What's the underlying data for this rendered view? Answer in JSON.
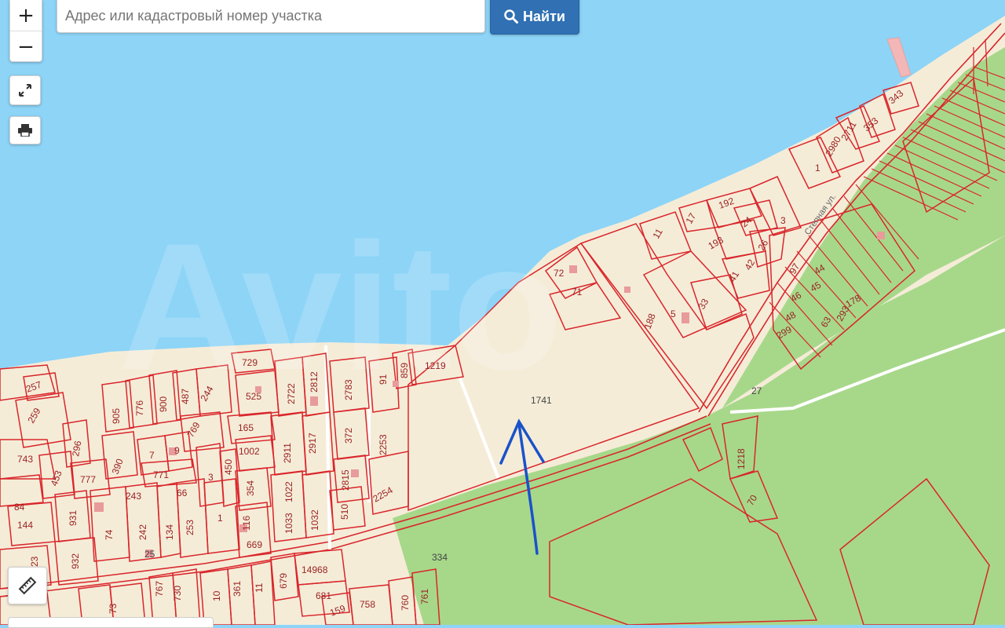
{
  "search": {
    "placeholder": "Адрес или кадастровый номер участка",
    "button_label": "Найти"
  },
  "controls": {
    "zoom_in": "+",
    "zoom_out": "−"
  },
  "watermark": "Avito",
  "street_label": "Степная ул.",
  "colors": {
    "water": "#8dd4f7",
    "land": "#f5ecd8",
    "forest": "#a7d88a",
    "parcel_border": "#d9262b",
    "arrow": "#1a52c9",
    "button": "#3070b3"
  },
  "parcels": {
    "p1741": "1741",
    "p334": "334",
    "p1219": "1219",
    "p2254": "2254",
    "p1218": "1218",
    "p70": "70",
    "p27": "27",
    "p188": "188",
    "p5": "5",
    "p33": "33",
    "p72": "72",
    "p71": "71",
    "p11": "11",
    "p17": "17",
    "p192": "192",
    "p193": "193",
    "p24": "24",
    "p3": "3",
    "p26": "26",
    "p42": "42",
    "p41": "41",
    "p1": "1",
    "p2980": "2980",
    "p2711": "2711",
    "p353": "353",
    "p343": "343",
    "p97": "97",
    "p44": "44",
    "p46": "46",
    "p45": "45",
    "p178": "178",
    "p293": "293",
    "p48": "48",
    "p63": "63",
    "p299": "299",
    "p729": "729",
    "p525": "525",
    "p2722": "2722",
    "p2812": "2812",
    "p2783": "2783",
    "p91": "91",
    "p859": "859",
    "p257": "257",
    "p259": "259",
    "p905": "905",
    "p776": "776",
    "p900": "900",
    "p487": "487",
    "p244": "244",
    "p769": "769",
    "p165": "165",
    "p2911": "2911",
    "p2917": "2917",
    "p372": "372",
    "p2253": "2253",
    "p743": "743",
    "p296": "296",
    "p390": "390",
    "p7": "7",
    "p9": "9",
    "p1002": "1002",
    "p453": "453",
    "p777": "777",
    "p771": "771",
    "p450": "450",
    "p3b": "3",
    "p354": "354",
    "p1022": "1022",
    "p2815": "2815",
    "p84": "84",
    "p243": "243",
    "p66": "66",
    "p144": "144",
    "p931": "931",
    "p74": "74",
    "p242": "242",
    "p134": "134",
    "p253": "253",
    "p1b": "1",
    "p116": "116",
    "p1033": "1033",
    "p1032": "1032",
    "p510": "510",
    "p669": "669",
    "p932": "932",
    "p23": "23",
    "p25": "25",
    "p767": "767",
    "p730": "730",
    "p10": "10",
    "p361": "361",
    "p11b": "11",
    "p679": "679",
    "p14968": "14968",
    "p681": "681",
    "p159": "159",
    "p758": "758",
    "p760": "760",
    "p761": "761",
    "p73": "73"
  }
}
